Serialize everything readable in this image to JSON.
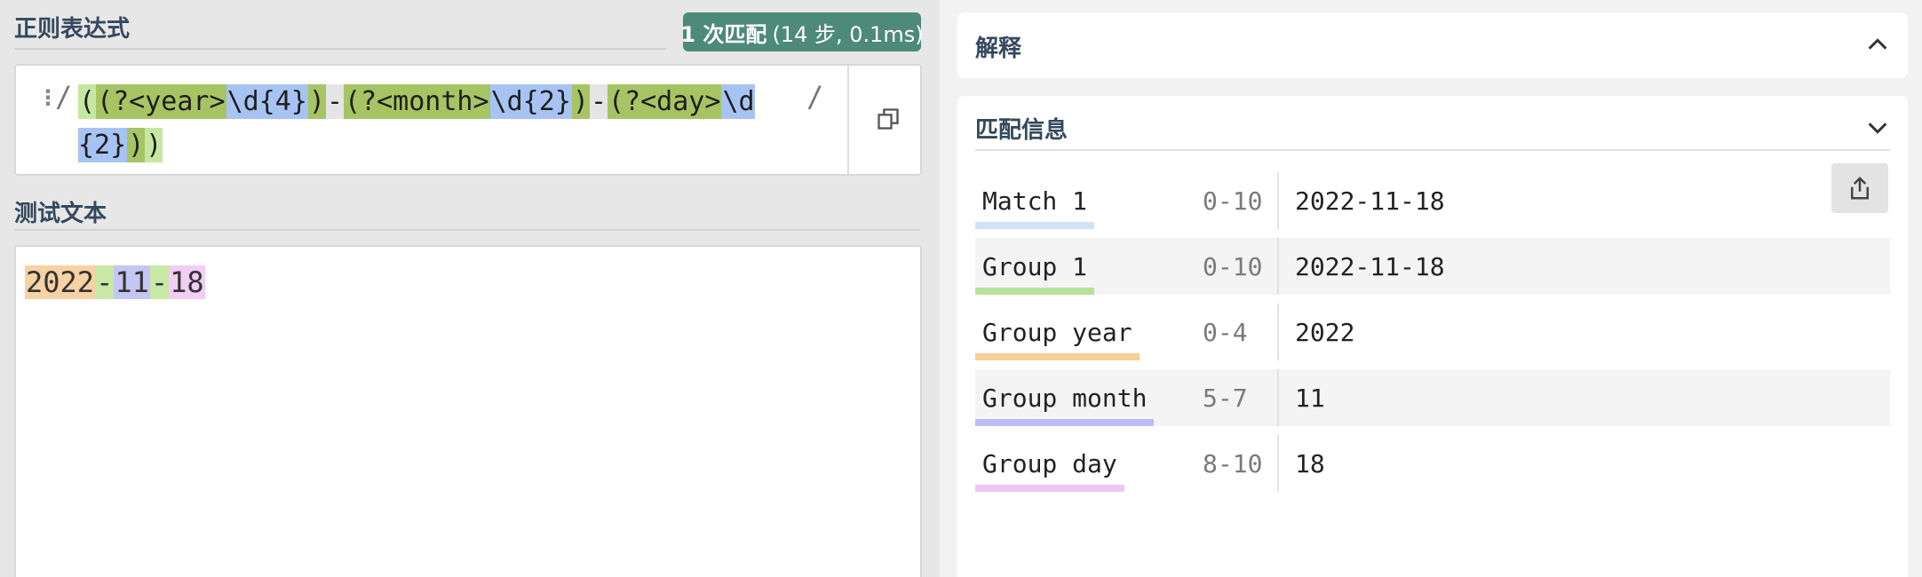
{
  "regex_panel": {
    "title": "正则表达式",
    "badge": {
      "count": "1 次匹配",
      "detail": "(14 步, 0.1ms)"
    },
    "slash_open": "/",
    "slash_close": "/",
    "drag_handle": "⋮",
    "tokens": [
      {
        "text": "(",
        "kind": "g-outer"
      },
      {
        "text": "(?<year>",
        "kind": "g-name"
      },
      {
        "text": "\\d{4}",
        "kind": "t-escape"
      },
      {
        "text": ")",
        "kind": "g-name"
      },
      {
        "text": "-",
        "kind": "t-lit"
      },
      {
        "text": "(?<month>",
        "kind": "g-name"
      },
      {
        "text": "\\d{2}",
        "kind": "t-escape"
      },
      {
        "text": ")",
        "kind": "g-name"
      },
      {
        "text": "-",
        "kind": "t-lit"
      },
      {
        "text": "(?<day>",
        "kind": "g-name"
      },
      {
        "text": "\\d{2}",
        "kind": "t-escape"
      },
      {
        "text": ")",
        "kind": "g-name"
      },
      {
        "text": ")",
        "kind": "g-outer"
      }
    ]
  },
  "test_panel": {
    "title": "测试文本",
    "segments": [
      {
        "text": "2022",
        "kind": "h-year"
      },
      {
        "text": "-",
        "kind": "h-dash"
      },
      {
        "text": "11",
        "kind": "h-month"
      },
      {
        "text": "-",
        "kind": "h-dash"
      },
      {
        "text": "18",
        "kind": "h-day"
      }
    ]
  },
  "explain": {
    "title": "解释"
  },
  "match_info": {
    "title": "匹配信息",
    "rows": [
      {
        "label": "Match 1",
        "range": "0-10",
        "value": "2022-11-18",
        "color": "#cfe3f5",
        "shaded": false
      },
      {
        "label": "Group 1",
        "range": "0-10",
        "value": "2022-11-18",
        "color": "#b6e29b",
        "shaded": true
      },
      {
        "label": "Group year",
        "range": "0-4",
        "value": "2022",
        "color": "#f6cf98",
        "shaded": false
      },
      {
        "label": "Group month",
        "range": "5-7",
        "value": "11",
        "color": "#bdbdf6",
        "shaded": true
      },
      {
        "label": "Group day",
        "range": "8-10",
        "value": "18",
        "color": "#f0c6f5",
        "shaded": false
      }
    ]
  }
}
